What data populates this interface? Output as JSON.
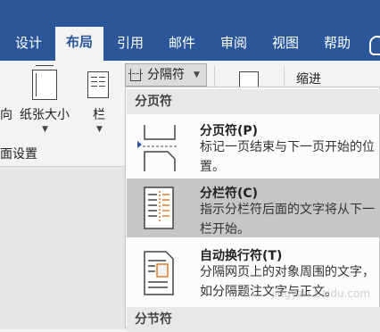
{
  "tabs": [
    {
      "label": "设计",
      "active": false
    },
    {
      "label": "布局",
      "active": true
    },
    {
      "label": "引用",
      "active": false
    },
    {
      "label": "邮件",
      "active": false
    },
    {
      "label": "审阅",
      "active": false
    },
    {
      "label": "视图",
      "active": false
    },
    {
      "label": "帮助",
      "active": false
    }
  ],
  "ribbon": {
    "orientation_label": "向",
    "size_label": "纸张大小",
    "columns_label": "栏",
    "breaks_label": "分隔符",
    "indent_label": "缩进",
    "group_label": "面设置"
  },
  "dropdown": {
    "page_section": "分页符",
    "section_section": "分节符",
    "items": [
      {
        "title": "分页符(P)",
        "desc": "标记一页结束与下一页开始的位置。"
      },
      {
        "title": "分栏符(C)",
        "desc": "指示分栏符后面的文字将从下一栏开始。"
      },
      {
        "title": "自动换行符(T)",
        "desc": "分隔网页上的对象周围的文字，如分隔题注文字与正文。"
      }
    ]
  },
  "colors": {
    "ribbon": "#2b579a",
    "selected": "#c6c6c6",
    "accent": "#e07a2f"
  },
  "watermark": "jingyan.baidu.com"
}
